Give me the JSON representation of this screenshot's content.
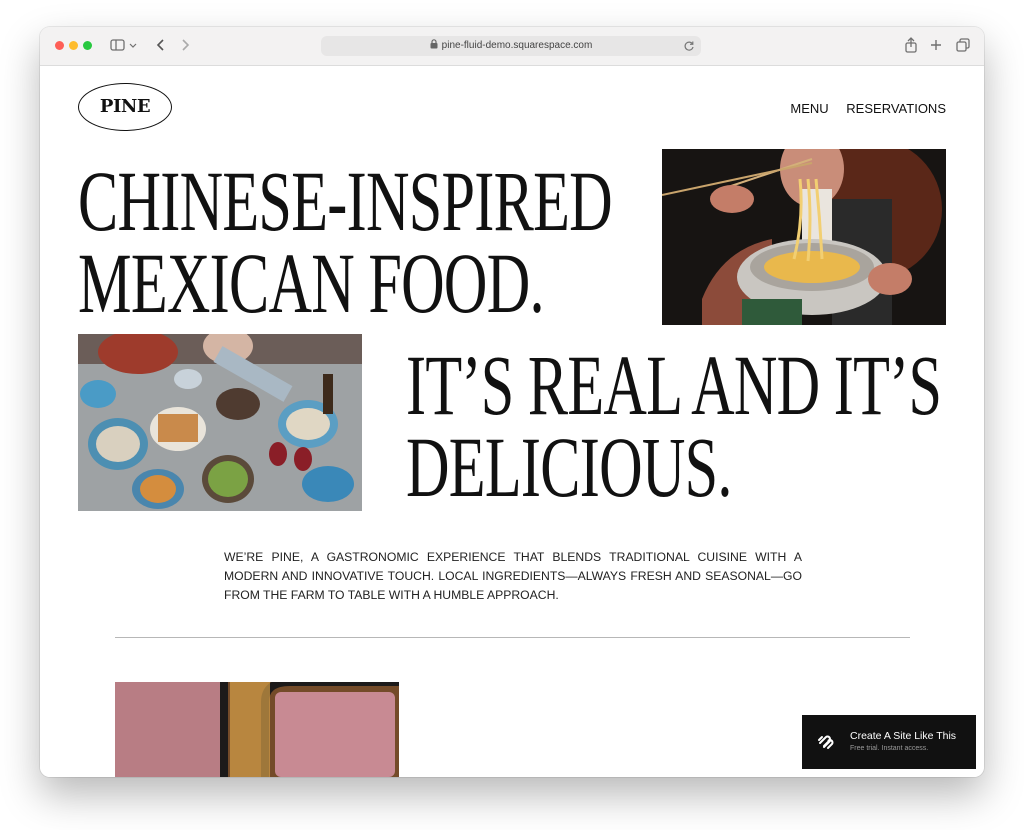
{
  "browser": {
    "url": "pine-fluid-demo.squarespace.com"
  },
  "site": {
    "logo": "PINE",
    "nav": [
      "MENU",
      "RESERVATIONS"
    ]
  },
  "hero": {
    "headline_line1": "CHINESE-INSPIRED",
    "headline_line2": "MEXICAN FOOD.",
    "subheadline_line1": "IT’S REAL AND IT’S",
    "subheadline_line2": "DELICIOUS."
  },
  "intro": {
    "text": "WE’RE PINE, A GASTRONOMIC EXPERIENCE THAT BLENDS TRADITIONAL CUISINE WITH A MODERN AND INNOVATIVE TOUCH. LOCAL INGREDIENTS—ALWAYS FRESH AND SEASONAL—GO FROM THE FARM TO TABLE WITH A HUMBLE APPROACH."
  },
  "cta": {
    "title": "Create A Site Like This",
    "subtitle": "Free trial. Instant access."
  }
}
